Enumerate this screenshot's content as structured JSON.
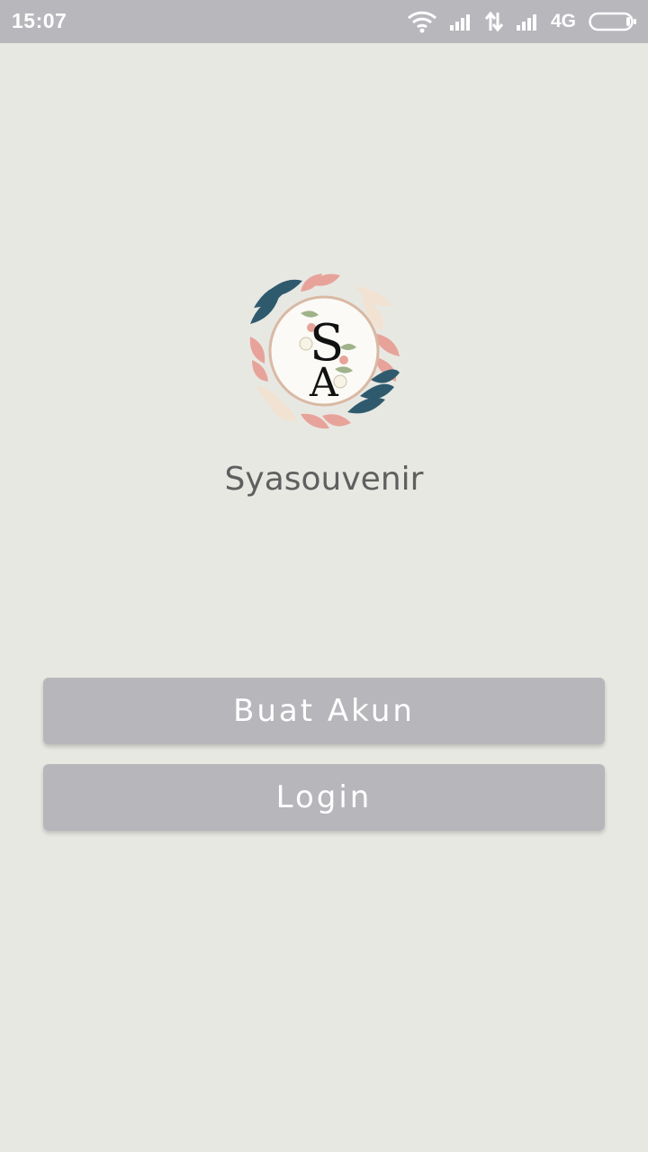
{
  "status_bar": {
    "time": "15:07",
    "network_label": "4G",
    "icons": [
      "wifi-icon",
      "signal-icon",
      "data-transfer-icon",
      "signal-icon",
      "battery-icon"
    ]
  },
  "logo": {
    "monogram": "SA",
    "colors": {
      "leaf_blue": "#2f5a6e",
      "leaf_pink": "#e7a39a",
      "leaf_cream": "#f1e2d2",
      "ring": "#d9b9a4"
    }
  },
  "app": {
    "name": "Syasouvenir"
  },
  "buttons": {
    "create_account": "Buat Akun",
    "login": "Login"
  },
  "colors": {
    "background": "#e8e8e3",
    "status_bar": "#b8b7bc",
    "button": "#b7b6bb",
    "button_text": "#ffffff",
    "app_name_text": "#5f5f5f"
  }
}
